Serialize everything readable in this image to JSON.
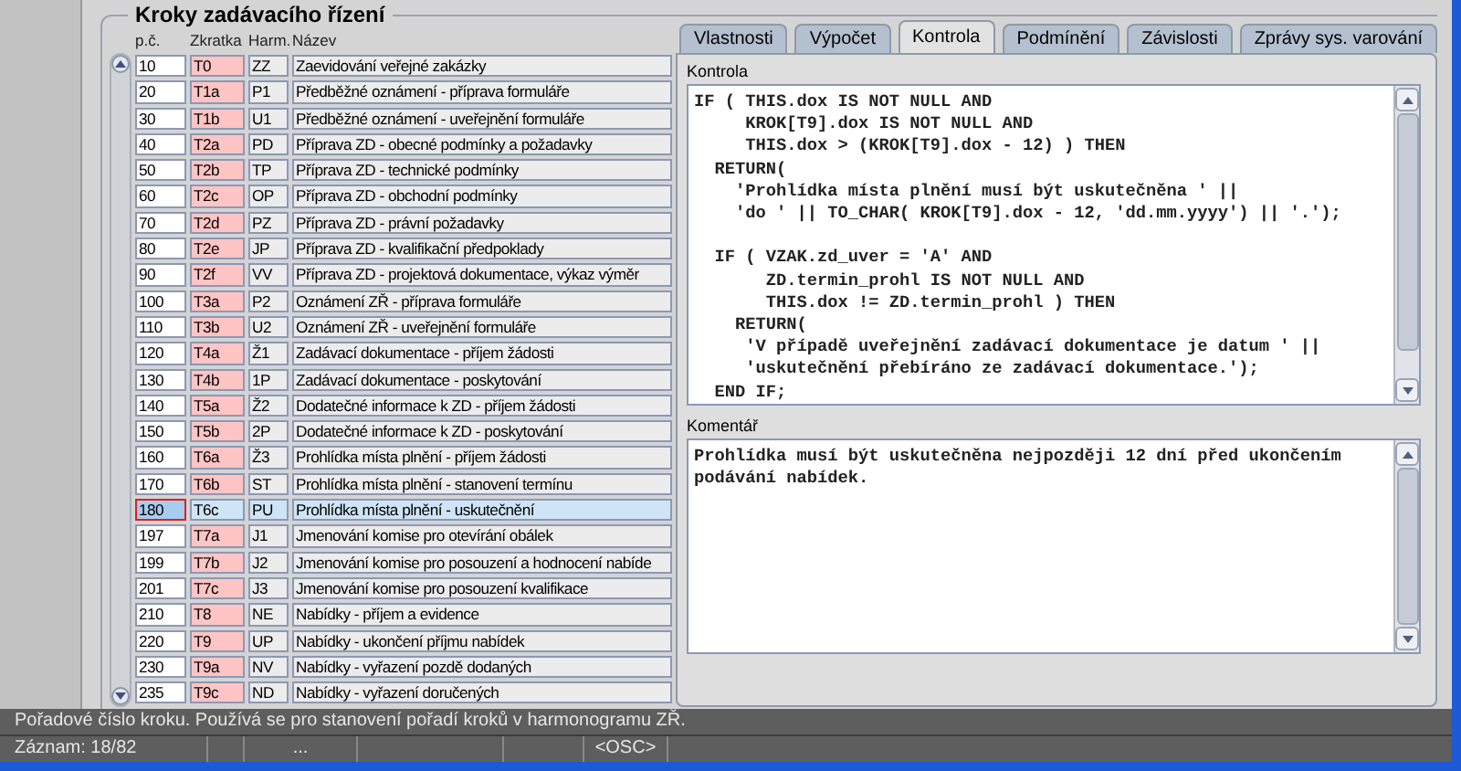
{
  "section_title": "Kroky zadávacího řízení",
  "columns": [
    "p.č.",
    "Zkratka",
    "Harm.",
    "Název"
  ],
  "rows": [
    {
      "number": "10",
      "abbr": "T0",
      "harm": "ZZ",
      "name": "Zaevidování veřejné zakázky",
      "selected": false
    },
    {
      "number": "20",
      "abbr": "T1a",
      "harm": "P1",
      "name": "Předběžné oznámení - příprava formuláře",
      "selected": false
    },
    {
      "number": "30",
      "abbr": "T1b",
      "harm": "U1",
      "name": "Předběžné oznámení - uveřejnění formuláře",
      "selected": false
    },
    {
      "number": "40",
      "abbr": "T2a",
      "harm": "PD",
      "name": "Příprava ZD - obecné podmínky a požadavky",
      "selected": false
    },
    {
      "number": "50",
      "abbr": "T2b",
      "harm": "TP",
      "name": "Příprava ZD - technické podmínky",
      "selected": false
    },
    {
      "number": "60",
      "abbr": "T2c",
      "harm": "OP",
      "name": "Příprava ZD - obchodní podmínky",
      "selected": false
    },
    {
      "number": "70",
      "abbr": "T2d",
      "harm": "PZ",
      "name": "Příprava ZD - právní požadavky",
      "selected": false
    },
    {
      "number": "80",
      "abbr": "T2e",
      "harm": "JP",
      "name": "Příprava ZD - kvalifikační předpoklady",
      "selected": false
    },
    {
      "number": "90",
      "abbr": "T2f",
      "harm": "VV",
      "name": "Příprava ZD - projektová dokumentace, výkaz výměr",
      "selected": false
    },
    {
      "number": "100",
      "abbr": "T3a",
      "harm": "P2",
      "name": "Oznámení ZŘ - příprava formuláře",
      "selected": false
    },
    {
      "number": "110",
      "abbr": "T3b",
      "harm": "U2",
      "name": "Oznámení ZŘ - uveřejnění formuláře",
      "selected": false
    },
    {
      "number": "120",
      "abbr": "T4a",
      "harm": "Ž1",
      "name": "Zadávací dokumentace - příjem žádosti",
      "selected": false
    },
    {
      "number": "130",
      "abbr": "T4b",
      "harm": "1P",
      "name": "Zadávací dokumentace - poskytování",
      "selected": false
    },
    {
      "number": "140",
      "abbr": "T5a",
      "harm": "Ž2",
      "name": "Dodatečné informace k ZD - příjem žádosti",
      "selected": false
    },
    {
      "number": "150",
      "abbr": "T5b",
      "harm": "2P",
      "name": "Dodatečné informace k ZD - poskytování",
      "selected": false
    },
    {
      "number": "160",
      "abbr": "T6a",
      "harm": "Ž3",
      "name": "Prohlídka místa plnění - příjem žádosti",
      "selected": false
    },
    {
      "number": "170",
      "abbr": "T6b",
      "harm": "ST",
      "name": "Prohlídka místa plnění - stanovení termínu",
      "selected": false
    },
    {
      "number": "180",
      "abbr": "T6c",
      "harm": "PU",
      "name": "Prohlídka místa plnění - uskutečnění",
      "selected": true
    },
    {
      "number": "197",
      "abbr": "T7a",
      "harm": "J1",
      "name": "Jmenování komise pro otevírání obálek",
      "selected": false
    },
    {
      "number": "199",
      "abbr": "T7b",
      "harm": "J2",
      "name": "Jmenování komise pro posouzení a hodnocení nabíde",
      "selected": false
    },
    {
      "number": "201",
      "abbr": "T7c",
      "harm": "J3",
      "name": "Jmenování komise pro posouzení kvalifikace",
      "selected": false
    },
    {
      "number": "210",
      "abbr": "T8",
      "harm": "NE",
      "name": "Nabídky - příjem a evidence",
      "selected": false
    },
    {
      "number": "220",
      "abbr": "T9",
      "harm": "UP",
      "name": "Nabídky - ukončení příjmu nabídek",
      "selected": false
    },
    {
      "number": "230",
      "abbr": "T9a",
      "harm": "NV",
      "name": "Nabídky - vyřazení pozdě dodaných",
      "selected": false
    },
    {
      "number": "235",
      "abbr": "T9c",
      "harm": "ND",
      "name": "Nabídky - vyřazení doručených",
      "selected": false
    }
  ],
  "tabs": [
    {
      "label": "Vlastnosti",
      "selected": false
    },
    {
      "label": "Výpočet",
      "selected": false
    },
    {
      "label": "Kontrola",
      "selected": true
    },
    {
      "label": "Podmínění",
      "selected": false
    },
    {
      "label": "Závislosti",
      "selected": false
    },
    {
      "label": "Zprávy sys. varování",
      "selected": false
    }
  ],
  "panel": {
    "code_label": "Kontrola",
    "code": "IF ( THIS.dox IS NOT NULL AND\n     KROK[T9].dox IS NOT NULL AND\n     THIS.dox > (KROK[T9].dox - 12) ) THEN\n  RETURN(\n    'Prohlídka místa plnění musí být uskutečněna ' ||\n    'do ' || TO_CHAR( KROK[T9].dox - 12, 'dd.mm.yyyy') || '.');\n\n  IF ( VZAK.zd_uver = 'A' AND\n       ZD.termin_prohl IS NOT NULL AND\n       THIS.dox != ZD.termin_prohl ) THEN\n    RETURN(\n     'V případě uveřejnění zadávací dokumentace je datum ' ||\n     'uskutečnění přebíráno ze zadávací dokumentace.');\n  END IF;",
    "comment_label": "Komentář",
    "comment": "Prohlídka musí být uskutečněna nejpozději 12 dní před ukončením\npodávání nabídek."
  },
  "status_bar": {
    "hint": "Pořadové číslo kroku. Používá se pro stanovení pořadí kroků v harmonogramu ZŘ.",
    "record": "Záznam: 18/82",
    "field_3": "...",
    "mode": "<OSC>"
  }
}
